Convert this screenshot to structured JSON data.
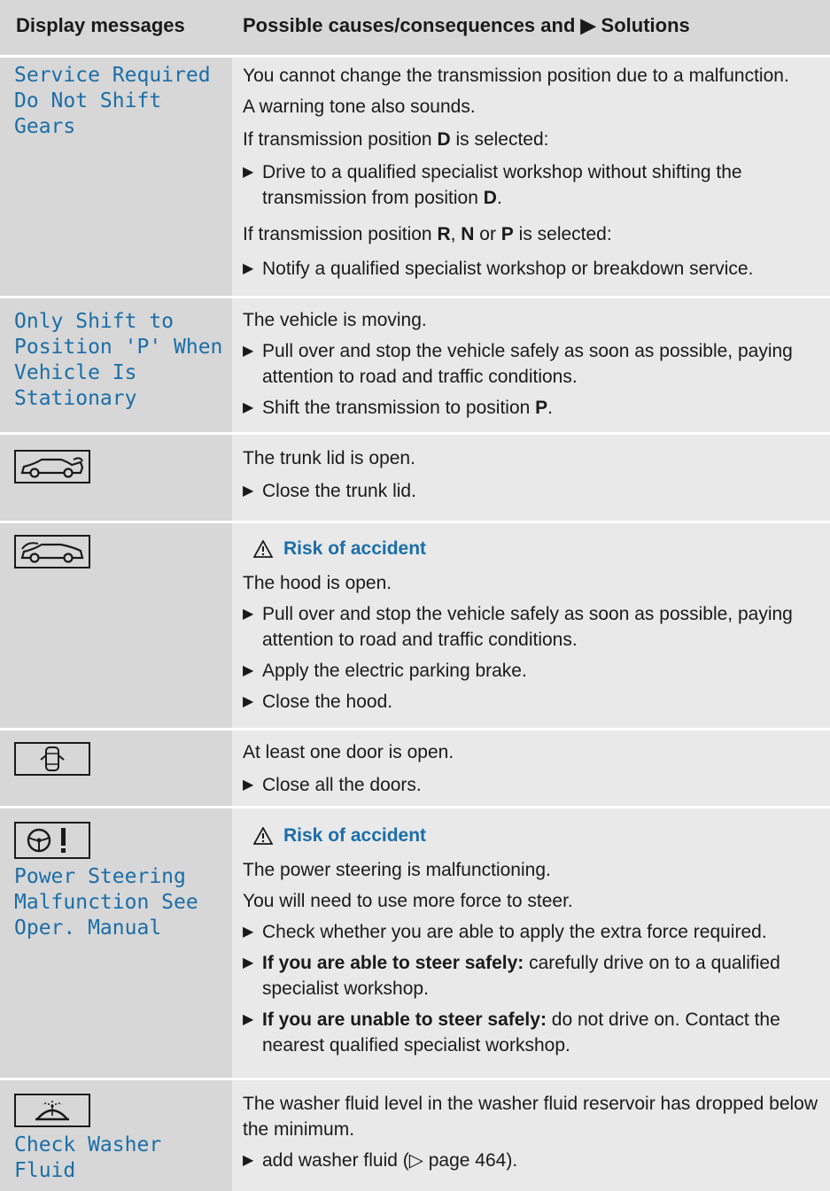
{
  "header": {
    "col1": "Display messages",
    "col2": "Possible causes/consequences and ▶ Solutions"
  },
  "rows": {
    "service": {
      "display": "Service Required\nDo Not Shift Gears",
      "p1": "You cannot change the transmission position due to a malfunction.",
      "p2": "A warning tone also sounds.",
      "p3_pre": "If transmission position ",
      "p3_bold": "D",
      "p3_post": " is selected:",
      "b1_pre": "Drive to a qualified specialist workshop without shifting the transmission from position ",
      "b1_bold": "D",
      "b1_post": ".",
      "p4_pre": "If transmission position ",
      "p4_r": "R",
      "p4_sep": ", ",
      "p4_n": "N",
      "p4_or": " or ",
      "p4_p": "P",
      "p4_post": " is selected:",
      "b2": "Notify a qualified specialist workshop or breakdown service."
    },
    "shift_p": {
      "display": "Only Shift to\nPosition 'P' When\nVehicle Is\nStationary",
      "p1": "The vehicle is moving.",
      "b1": "Pull over and stop the vehicle safely as soon as possible, paying attention to road and traffic conditions.",
      "b2_pre": "Shift the transmission to position ",
      "b2_bold": "P",
      "b2_post": "."
    },
    "trunk": {
      "icon": "trunk-open-icon",
      "p1": "The trunk lid is open.",
      "b1": "Close the trunk lid."
    },
    "hood": {
      "icon": "hood-open-icon",
      "warning": "Risk of accident",
      "p1": "The hood is open.",
      "b1": "Pull over and stop the vehicle safely as soon as possible, paying attention to road and traffic conditions.",
      "b2": "Apply the electric parking brake.",
      "b3": "Close the hood."
    },
    "door": {
      "icon": "door-open-icon",
      "p1": "At least one door is open.",
      "b1": "Close all the doors."
    },
    "steering": {
      "icon": "steering-malfunction-icon",
      "display": "Power Steering\nMalfunction See\nOper. Manual",
      "warning": "Risk of accident",
      "p1": "The power steering is malfunctioning.",
      "p2": "You will need to use more force to steer.",
      "b1": "Check whether you are able to apply the extra force required.",
      "b2_bold": "If you are able to steer safely:",
      "b2_post": " carefully drive on to a qualified specialist workshop.",
      "b3_bold": "If you are unable to steer safely:",
      "b3_post": " do not drive on. Contact the nearest qualified specialist workshop."
    },
    "washer": {
      "icon": "washer-fluid-icon",
      "display": "Check Washer Fluid",
      "p1": "The washer fluid level in the washer fluid reservoir has dropped below the minimum.",
      "b1": "add washer fluid (▷ page 464)."
    }
  },
  "colors": {
    "header_bg": "#d7d7d7",
    "left_bg": "#d7d7d7",
    "right_bg": "#e9e9e9",
    "accent": "#1b6ea8"
  }
}
